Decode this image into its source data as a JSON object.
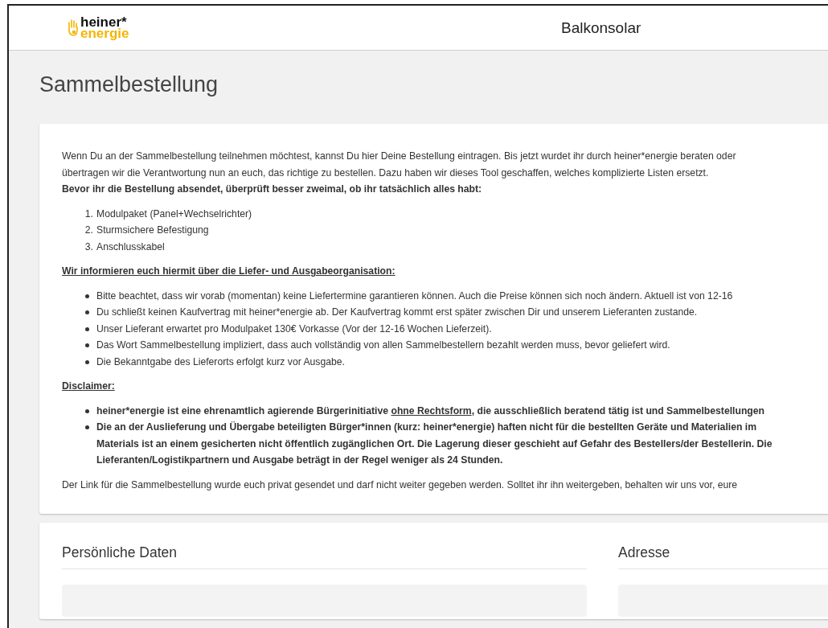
{
  "header": {
    "logo_top": "heiner*",
    "logo_bottom": "energie",
    "title": "Balkonsolar"
  },
  "page_title": "Sammelbestellung",
  "info": {
    "intro_lines": [
      "Wenn Du an der Sammelbestellung teilnehmen möchtest, kannst Du hier Deine Bestellung eintragen. Bis jetzt wurdet ihr durch heiner*energie beraten oder",
      "übertragen wir die Verantwortung nun an euch, das richtige zu bestellen. Dazu haben wir dieses Tool geschaffen, welches komplizierte Listen ersetzt."
    ],
    "checklist_title": "Bevor ihr die Bestellung absendet, überprüft besser zweimal, ob ihr tatsächlich alles habt:",
    "checklist": [
      {
        "number": "1.",
        "text": "Modulpaket (Panel+Wechselrichter)"
      },
      {
        "number": "2.",
        "text": "Sturmsichere Befestigung"
      },
      {
        "number": "3.",
        "text": "Anschlusskabel"
      }
    ],
    "organisation_title": "Wir informieren euch hiermit über die Liefer- und Ausgabeorganisation:",
    "organisation_items": [
      "Bitte beachtet, dass wir vorab (momentan) keine Liefertermine garantieren können. Auch die Preise können sich noch ändern. Aktuell ist von 12-16",
      "Du schließt keinen Kaufvertrag mit heiner*energie ab. Der Kaufvertrag kommt erst später zwischen Dir und unserem Lieferanten zustande.",
      "Unser Lieferant erwartet pro Modulpaket 130€ Vorkasse (Vor der 12-16 Wochen Lieferzeit).",
      "Das Wort Sammelbestellung impliziert, dass auch vollständig von allen Sammelbestellern bezahlt werden muss, bevor geliefert wird.",
      "Die Bekanntgabe des Lieferorts erfolgt kurz vor Ausgabe."
    ],
    "disclaimer_title": "Disclaimer:",
    "disclaimer_items": [
      {
        "segments": [
          {
            "kind": "text",
            "text": "heiner*energie ist eine ehrenamtlich agierende Bürgerinitiative "
          },
          {
            "kind": "link",
            "text": "ohne Rechtsform"
          },
          {
            "kind": "text",
            "text": ", die ausschließlich beratend tätig ist und Sammelbestellungen"
          }
        ]
      },
      {
        "lines": [
          "Die an der Auslieferung und Übergabe beteiligten Bürger*innen (kurz: heiner*energie) haften nicht für die bestellten Geräte und Materialien im",
          "Materials ist an einem gesicherten nicht öffentlich zugänglichen Ort. Die Lagerung dieser geschieht auf Gefahr des Bestellers/der Bestellerin. Die",
          "Lieferanten/Logistikpartnern und Ausgabe beträgt in der Regel weniger als 24 Stunden."
        ]
      }
    ],
    "closing": "Der Link für die Sammelbestellung wurde euch privat gesendet und darf nicht weiter gegeben werden. Solltet ihr ihn weitergeben, behalten wir uns vor, eure"
  },
  "form_sections": [
    {
      "title": "Persönliche Daten"
    },
    {
      "title": "Adresse"
    }
  ]
}
